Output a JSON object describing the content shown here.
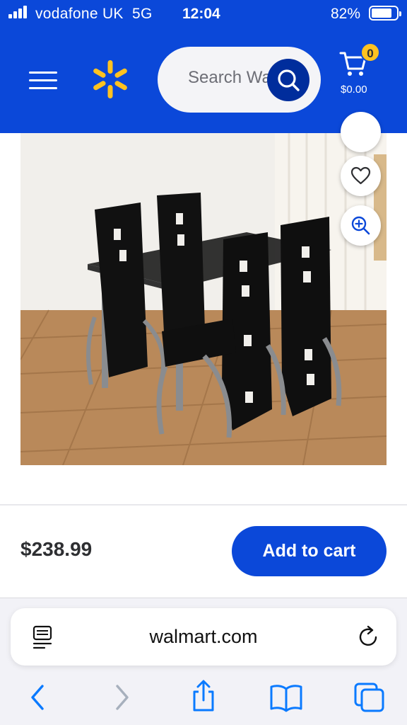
{
  "status_bar": {
    "carrier": "vodafone UK",
    "network": "5G",
    "time": "12:04",
    "battery_percent": "82%",
    "battery_level": 0.82
  },
  "header": {
    "menu_icon": "hamburger-menu-icon",
    "logo_icon": "walmart-spark-icon",
    "search_placeholder": "Search Walmart",
    "search_icon": "search-icon",
    "cart_icon": "shopping-cart-icon",
    "cart_count": "0",
    "cart_total": "$0.00"
  },
  "product": {
    "image_description_icon": "product-photo",
    "favorite_icon": "heart-icon",
    "zoom_icon": "zoom-in-icon",
    "price": "$238.99",
    "add_to_cart_label": "Add to cart"
  },
  "browser": {
    "url": "walmart.com",
    "reader_icon": "reader-mode-icon",
    "reload_icon": "reload-icon",
    "toolbar_icons": [
      "back-icon",
      "forward-icon",
      "share-icon",
      "bookmarks-icon",
      "tabs-icon"
    ]
  },
  "colors": {
    "brand_blue": "#0b48d9",
    "dark_blue": "#002d9c",
    "spark_yellow": "#ffc220",
    "ios_blue": "#0a7aff"
  }
}
